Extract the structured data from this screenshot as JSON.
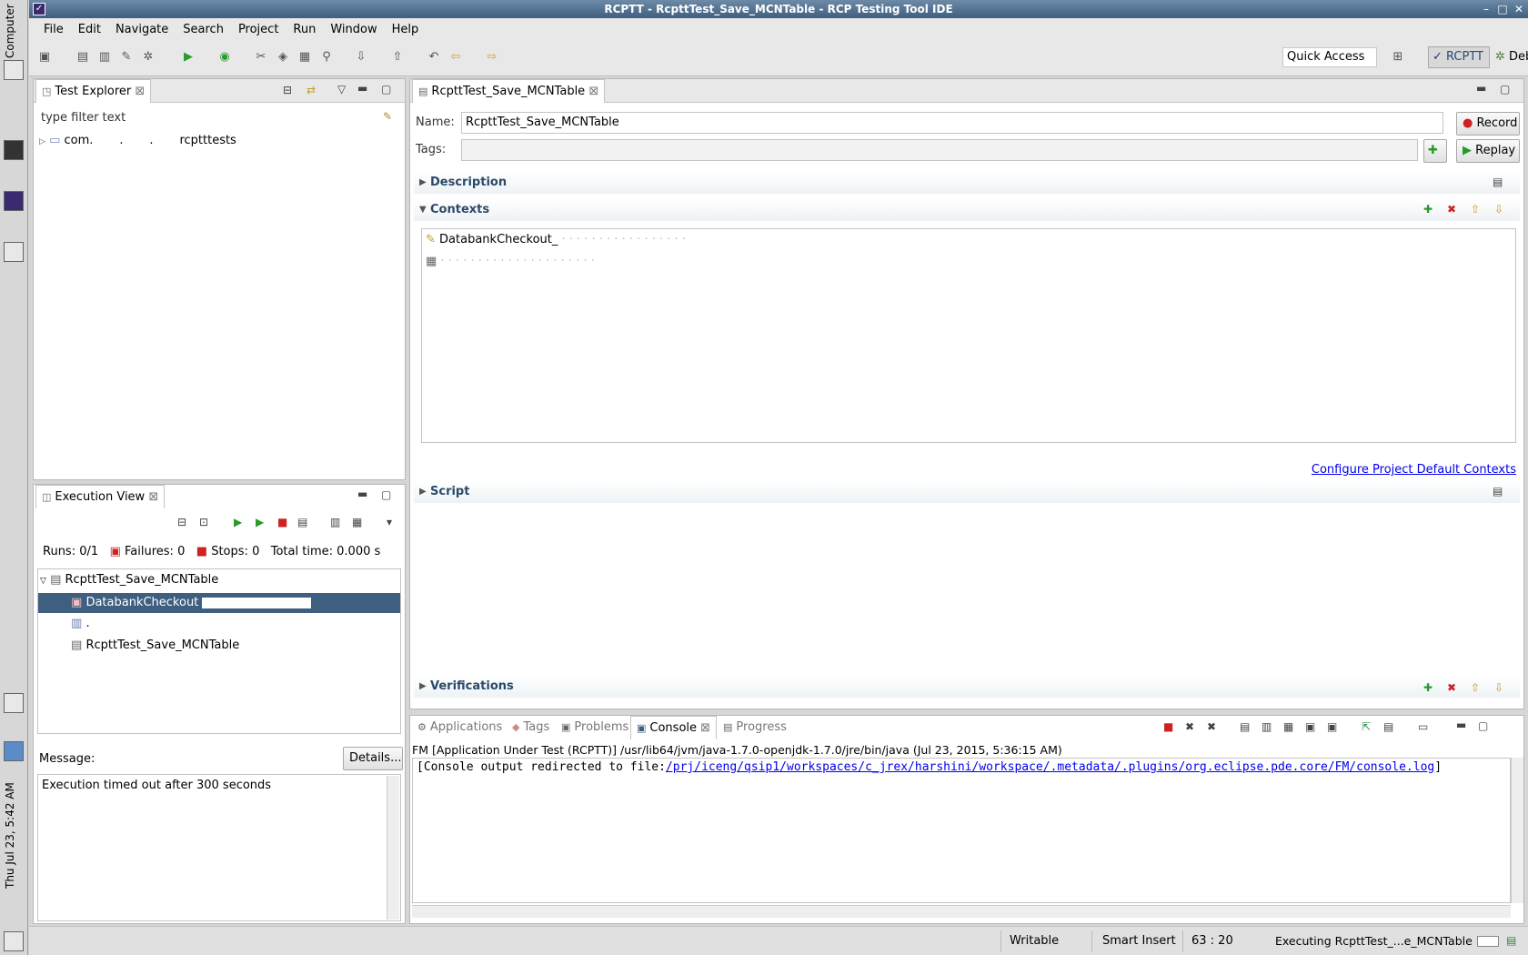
{
  "desktop": {
    "computer_label": "Computer",
    "clock": "Thu Jul 23,  5:42 AM"
  },
  "window": {
    "title": "RCPTT - RcpttTest_Save_MCNTable - RCP Testing Tool IDE",
    "controls": [
      "–",
      "□",
      "✕"
    ]
  },
  "menu": [
    "File",
    "Edit",
    "Navigate",
    "Search",
    "Project",
    "Run",
    "Window",
    "Help"
  ],
  "toolbar": {
    "quick_access": "Quick Access",
    "perspectives": [
      "RCPTT",
      "Debug"
    ]
  },
  "test_explorer": {
    "tab_label": "Test Explorer",
    "filter_placeholder": "type filter text",
    "tree": [
      {
        "label": "com.       .       .       rcptttests"
      }
    ]
  },
  "execution_view": {
    "tab_label": "Execution View",
    "runs_label": "Runs:",
    "runs_value": "0/1",
    "failures_label": "Failures:",
    "failures_value": "0",
    "stops_label": "Stops:",
    "stops_value": "0",
    "total_time_label": "Total time:",
    "total_time_value": "0.000 s",
    "tree": {
      "root": "RcpttTest_Save_MCNTable",
      "children": [
        "DatabankCheckout",
        ".",
        "RcpttTest_Save_MCNTable"
      ]
    },
    "message_label": "Message:",
    "details_button": "Details...",
    "message_text": "Execution timed out after 300 seconds"
  },
  "editor": {
    "tab_label": "RcpttTest_Save_MCNTable",
    "name_label": "Name:",
    "name_value": "RcpttTest_Save_MCNTable",
    "tags_label": "Tags:",
    "tags_value": "",
    "record_button": "Record",
    "replay_button": "Replay",
    "sections": {
      "description": "Description",
      "contexts": "Contexts",
      "script": "Script",
      "verifications": "Verifications"
    },
    "contexts_list": [
      "DatabankCheckout_",
      ""
    ],
    "configure_link": "Configure Project Default Contexts"
  },
  "bottom": {
    "tabs": [
      "Applications",
      "Tags",
      "Problems",
      "Console",
      "Progress"
    ],
    "active_tab": "Console",
    "console_header": "FM [Application Under Test (RCPTT)] /usr/lib64/jvm/java-1.7.0-openjdk-1.7.0/jre/bin/java (Jul 23, 2015, 5:36:15 AM)",
    "console_prefix": "[Console output redirected to file:",
    "console_link": "/prj/iceng/qsip1/workspaces/c_jrex/harshini/workspace/.metadata/.plugins/org.eclipse.pde.core/FM/console.log",
    "console_suffix": "]"
  },
  "status": {
    "writable": "Writable",
    "insert_mode": "Smart Insert",
    "position": "63 : 20",
    "executing": "Executing RcpttTest_...e_MCNTable"
  }
}
